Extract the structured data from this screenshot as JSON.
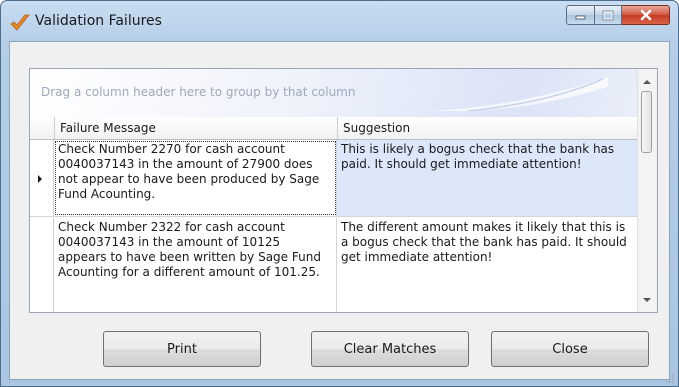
{
  "window": {
    "title": "Validation Failures"
  },
  "grid": {
    "group_hint": "Drag a column header here to group by that column",
    "columns": [
      "Failure Message",
      "Suggestion"
    ],
    "rows": [
      {
        "message": "Check Number 2270 for cash account 0040037143 in the amount of 27900 does not appear to have been produced by Sage Fund Acounting.",
        "suggestion": "This is likely a bogus check that the bank has paid. It should get immediate attention!",
        "selected": true
      },
      {
        "message": "Check Number 2322 for cash account 0040037143 in the amount of 10125 appears to have been written by Sage Fund Acounting for a different amount of 101.25.",
        "suggestion": "The different amount makes it likely that this is a bogus check that the bank has paid. It should get immediate attention!",
        "selected": false
      }
    ]
  },
  "buttons": {
    "print": "Print",
    "clear_matches": "Clear Matches",
    "close": "Close"
  },
  "icons": {
    "app": "checkmark-icon",
    "minimize": "minimize-icon",
    "maximize": "maximize-icon",
    "close": "close-icon"
  },
  "colors": {
    "app_icon": "#e8892a",
    "selection": "#dde7fa",
    "close_button": "#c43a21"
  }
}
